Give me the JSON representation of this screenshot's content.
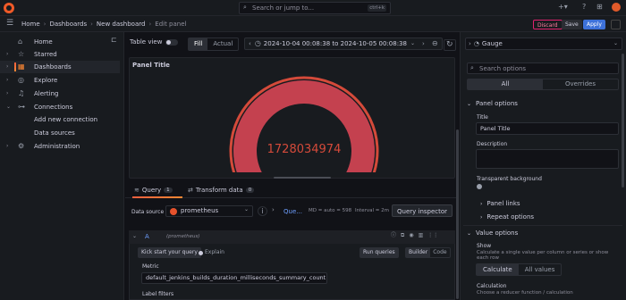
{
  "search": {
    "placeholder": "Search or jump to...",
    "shortcut": "ctrl+k"
  },
  "breadcrumb": [
    "Home",
    "Dashboards",
    "New dashboard",
    "Edit panel"
  ],
  "actions": {
    "discard": "Discard",
    "save": "Save",
    "apply": "Apply"
  },
  "sidebar": {
    "items": [
      {
        "label": "Home",
        "icon": "home-icon"
      },
      {
        "label": "Starred",
        "icon": "star-icon"
      },
      {
        "label": "Dashboards",
        "icon": "dashboards-icon",
        "active": true
      },
      {
        "label": "Explore",
        "icon": "compass-icon"
      },
      {
        "label": "Alerting",
        "icon": "bell-icon"
      },
      {
        "label": "Connections",
        "icon": "connections-icon"
      },
      {
        "label": "Add new connection",
        "sub": true
      },
      {
        "label": "Data sources",
        "sub": true
      },
      {
        "label": "Administration",
        "icon": "gear-icon"
      }
    ]
  },
  "toolbar": {
    "table_view": "Table view",
    "fill": "Fill",
    "actual": "Actual",
    "time_range": "2024-10-04 00:08:38 to 2024-10-05 00:08:38"
  },
  "panel": {
    "title": "Panel Title",
    "value": "1728034974",
    "gauge_fill": 1.0
  },
  "tabs": [
    {
      "label": "Query",
      "count": "1"
    },
    {
      "label": "Transform data",
      "count": "0"
    }
  ],
  "query_row": {
    "ds_label": "Data source",
    "ds_value": "prometheus",
    "query_options": "Que...",
    "md": "MD = auto = 598",
    "interval": "Interval = 2m",
    "inspector": "Query inspector"
  },
  "query_editor": {
    "ref": "A",
    "ds": "(prometheus)",
    "kick_start": "Kick start your query",
    "explain": "Explain",
    "run": "Run queries",
    "builder": "Builder",
    "code": "Code",
    "metric_label": "Metric",
    "metric_value": "default_jenkins_builds_duration_milliseconds_summary_count",
    "label_filters": "Label filters"
  },
  "options": {
    "viz": "Gauge",
    "search_placeholder": "Search options",
    "tab_all": "All",
    "tab_overrides": "Overrides",
    "panel_options": "Panel options",
    "title_label": "Title",
    "title_value": "Panel Title",
    "description_label": "Description",
    "transparent_label": "Transparent background",
    "panel_links": "Panel links",
    "repeat_options": "Repeat options",
    "value_options": "Value options",
    "show_label": "Show",
    "show_desc": "Calculate a single value per column or series or show each row",
    "calculate": "Calculate",
    "all_values": "All values",
    "calc_label": "Calculation",
    "calc_desc": "Choose a reducer function / calculation"
  },
  "colors": {
    "gauge": "#c4414f",
    "accent": "#ff8833",
    "primary": "#3d71d9"
  }
}
